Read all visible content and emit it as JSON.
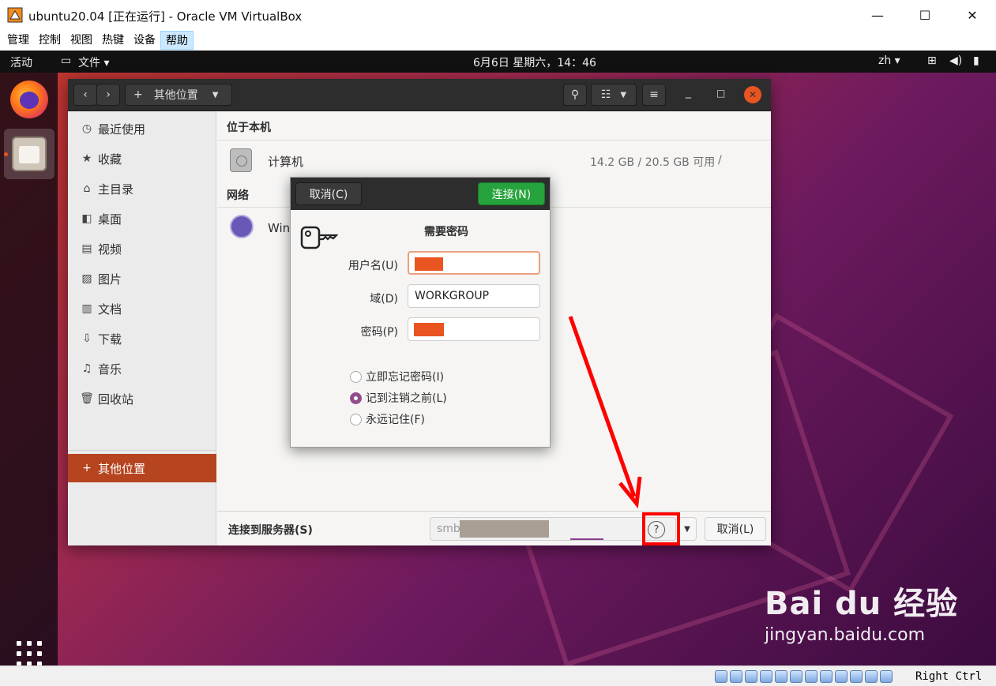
{
  "vbox": {
    "title": "ubuntu20.04 [正在运行] - Oracle VM VirtualBox",
    "menu": [
      "管理",
      "控制",
      "视图",
      "热键",
      "设备",
      "帮助"
    ],
    "active_menu_index": 5,
    "host_key": "Right Ctrl",
    "window_controls": {
      "minimize": "—",
      "maximize": "☐",
      "close": "✕"
    }
  },
  "gnome": {
    "activities": "活动",
    "app_menu": "文件 ▾",
    "clock": "6月6日 星期六，14：46",
    "lang": "zh ▾"
  },
  "files": {
    "location_button": "其他位置",
    "sidebar": [
      {
        "icon": "clock-icon",
        "glyph": "◷",
        "label": "最近使用"
      },
      {
        "icon": "star-icon",
        "glyph": "★",
        "label": "收藏"
      },
      {
        "icon": "home-icon",
        "glyph": "⌂",
        "label": "主目录"
      },
      {
        "icon": "desktop-icon",
        "glyph": "◧",
        "label": "桌面"
      },
      {
        "icon": "video-icon",
        "glyph": "▤",
        "label": "视频"
      },
      {
        "icon": "picture-icon",
        "glyph": "▨",
        "label": "图片"
      },
      {
        "icon": "document-icon",
        "glyph": "▥",
        "label": "文档"
      },
      {
        "icon": "download-icon",
        "glyph": "⇩",
        "label": "下载"
      },
      {
        "icon": "music-icon",
        "glyph": "♫",
        "label": "音乐"
      },
      {
        "icon": "trash-icon",
        "glyph": "🗑",
        "label": "回收站"
      }
    ],
    "other_locations": {
      "glyph": "+",
      "label": "其他位置"
    },
    "local_section": "位于本机",
    "computer": {
      "label": "计算机",
      "usage": "14.2 GB / 20.5 GB 可用",
      "path": "/"
    },
    "network_section": "网络",
    "network_item": "Win",
    "connect_label": "连接到服务器(S)",
    "server_prefix": "smb",
    "help_glyph": "?",
    "cancel_label": "取消(L)"
  },
  "dialog": {
    "cancel": "取消(C)",
    "connect": "连接(N)",
    "title": "需要密码",
    "username_label": "用户名(U)",
    "domain_label": "域(D)",
    "domain_value": "WORKGROUP",
    "password_label": "密码(P)",
    "options": [
      {
        "label": "立即忘记密码(I)",
        "selected": false
      },
      {
        "label": "记到注销之前(L)",
        "selected": true
      },
      {
        "label": "永远记住(F)",
        "selected": false
      }
    ],
    "redaction_color": "#e95420"
  },
  "annotation_color": "#ff0000",
  "watermark": {
    "logo": "Bai du 经验",
    "url": "jingyan.baidu.com"
  }
}
